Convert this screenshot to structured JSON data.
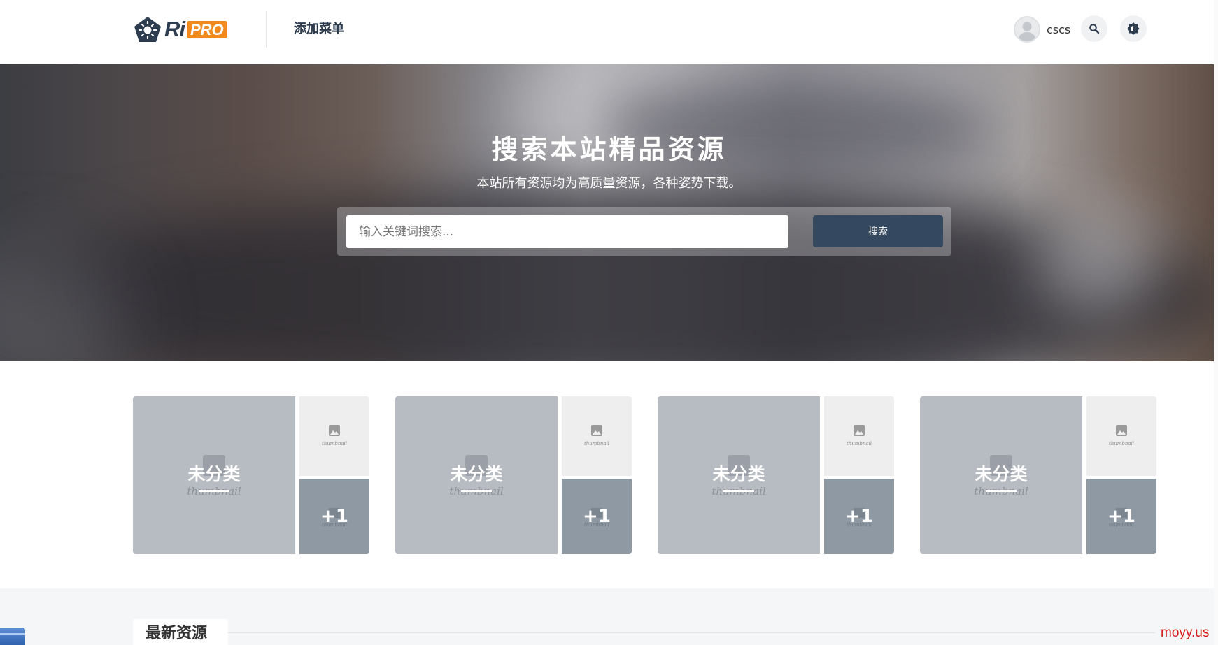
{
  "header": {
    "logo": {
      "ri": "Ri",
      "pro": "PRO"
    },
    "nav": [
      {
        "label": "添加菜单"
      }
    ],
    "user": {
      "name": "cscs"
    },
    "icons": {
      "search": "search-icon",
      "theme": "theme-toggle-icon",
      "avatar": "user-avatar-icon"
    }
  },
  "hero": {
    "title": "搜索本站精品资源",
    "subtitle": "本站所有资源均为高质量资源，各种姿势下载。",
    "search": {
      "placeholder": "输入关键词搜索...",
      "button_label": "搜索"
    }
  },
  "categories": [
    {
      "name": "未分类",
      "thumb_word": "thumbnail",
      "more": "+1"
    },
    {
      "name": "未分类",
      "thumb_word": "thumbnail",
      "more": "+1"
    },
    {
      "name": "未分类",
      "thumb_word": "thumbnail",
      "more": "+1"
    },
    {
      "name": "未分类",
      "thumb_word": "thumbnail",
      "more": "+1"
    }
  ],
  "latest": {
    "title": "最新资源"
  },
  "watermark": "moyy.us",
  "colors": {
    "brand_dark": "#34485f",
    "brand_orange": "#f08a1c",
    "watermark_red": "#d81b1b"
  }
}
